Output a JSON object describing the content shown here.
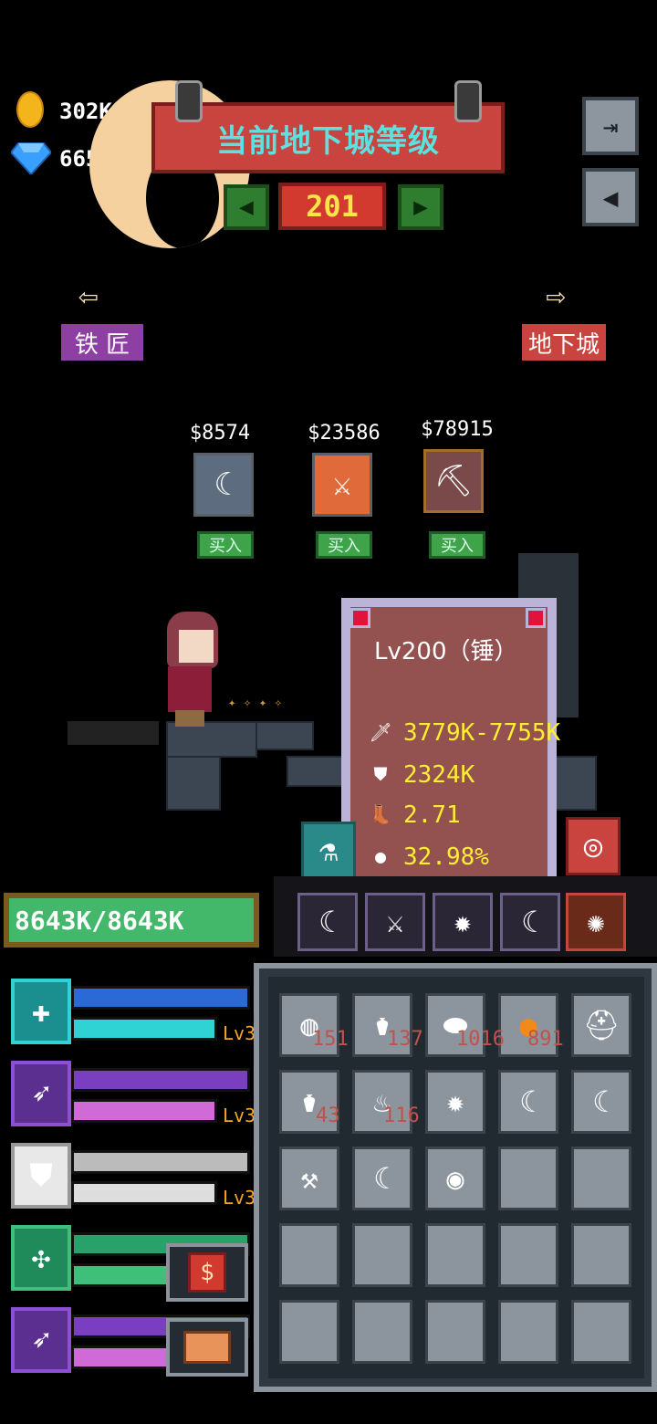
{
  "currency": {
    "gold": "302K",
    "gems": "665"
  },
  "banner": {
    "title": "当前地下城等级"
  },
  "level": {
    "value": "201",
    "prev_icon": "triangle-left-icon",
    "next_icon": "triangle-right-icon"
  },
  "nav": {
    "left_label": "铁 匠",
    "right_label": "地下城"
  },
  "shop": {
    "items": [
      {
        "price": "$8574",
        "buy": "买入",
        "icon": "scythe-icon"
      },
      {
        "price": "$23586",
        "buy": "买入",
        "icon": "sword-icon"
      },
      {
        "price": "$78915",
        "buy": "买入",
        "icon": "pickaxe-icon"
      }
    ]
  },
  "tooltip": {
    "title": "Lv200（锤）",
    "attack": "3779K-7755K",
    "defense": "2324K",
    "speed": "2.71",
    "crit": "32.98%"
  },
  "hp": {
    "text": "8643K/8643K"
  },
  "weapons": [
    {
      "lv": "Lv3",
      "color": "#2fd3d3"
    },
    {
      "lv": "Lv3",
      "color": "#8c4fd6"
    },
    {
      "lv": "Lv3",
      "color": "#d8d8d8"
    },
    {
      "lv": "",
      "color": "#3fc07a"
    },
    {
      "lv": "",
      "color": "#8c4fd6"
    }
  ],
  "inventory": {
    "counts_row1": [
      "151",
      "137",
      "1016",
      "891"
    ],
    "counts_row2": [
      "43",
      "116"
    ]
  },
  "buttons": {
    "shop_symbol": "$"
  }
}
